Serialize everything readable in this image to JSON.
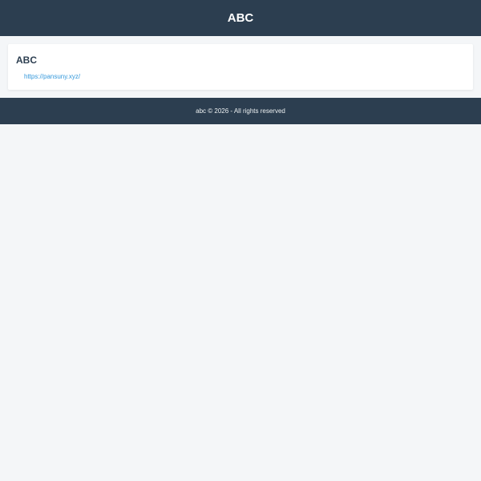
{
  "header": {
    "title": "ABC"
  },
  "card": {
    "title": "ABC",
    "link_text": "https://pansuny.xyz/"
  },
  "footer": {
    "text": "abc © 2026 - All rights reserved"
  },
  "colors": {
    "header_bg": "#2c3e50",
    "page_bg": "#f4f6f8",
    "link": "#3498db"
  }
}
